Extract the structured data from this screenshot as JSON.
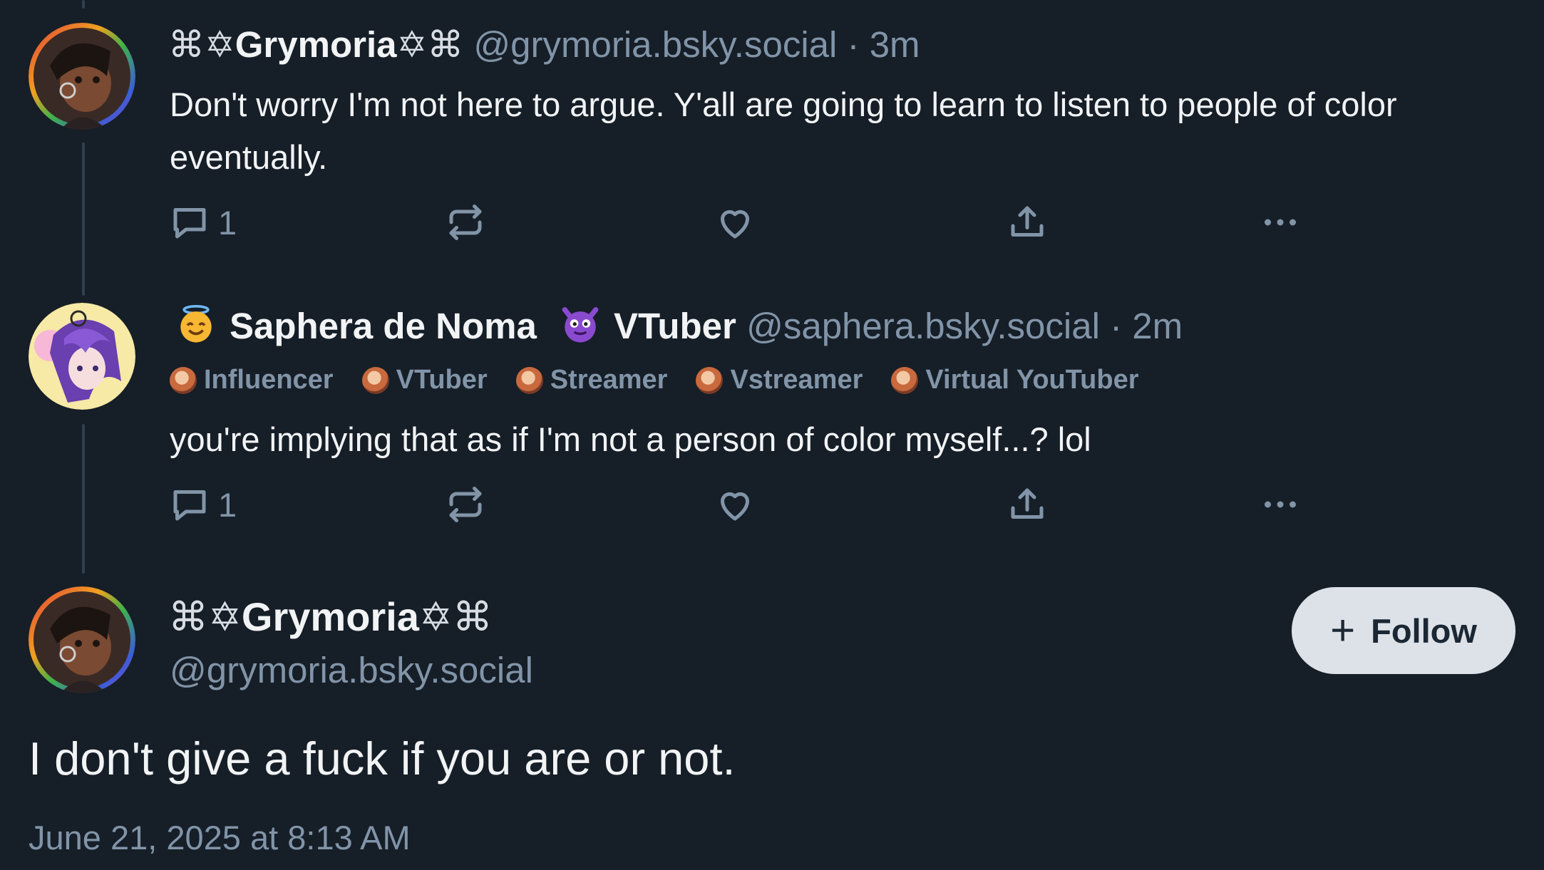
{
  "colors": {
    "background": "#161e27",
    "muted": "#8194a8",
    "text": "#f1f3f5",
    "follow_bg": "#dce2e8"
  },
  "posts": [
    {
      "author_name": "Grymoria",
      "deco_left": "⌘✡",
      "deco_right": "✡⌘",
      "handle": "@grymoria.bsky.social",
      "separator": "·",
      "time": "3m",
      "text": "Don't worry I'm not here to argue. Y'all are going to learn to listen to people of color eventually.",
      "reply_count": "1"
    },
    {
      "author_name_part1": "Saphera de Noma",
      "author_name_part2": "VTuber",
      "emoji_left": "smiling-face-with-halo",
      "emoji_mid": "smiling-face-with-horns",
      "handle": "@saphera.bsky.social",
      "separator": "·",
      "time": "2m",
      "labels": [
        "Influencer",
        "VTuber",
        "Streamer",
        "Vstreamer",
        "Virtual YouTuber"
      ],
      "text": "you're implying that as if I'm not a person of color myself...? lol",
      "reply_count": "1"
    }
  ],
  "focused_post": {
    "author_name": "Grymoria",
    "deco_left": "⌘✡",
    "deco_right": "✡⌘",
    "handle": "@grymoria.bsky.social",
    "follow_label": "Follow",
    "follow_plus": "+",
    "text": "I don't give a fuck if you are or not.",
    "date": "June 21, 2025 at 8:13 AM"
  },
  "icons": {
    "reply": "reply-bubble-icon",
    "repost": "repost-arrows-icon",
    "like": "heart-icon",
    "share": "share-upload-icon",
    "more": "more-dots-icon"
  }
}
